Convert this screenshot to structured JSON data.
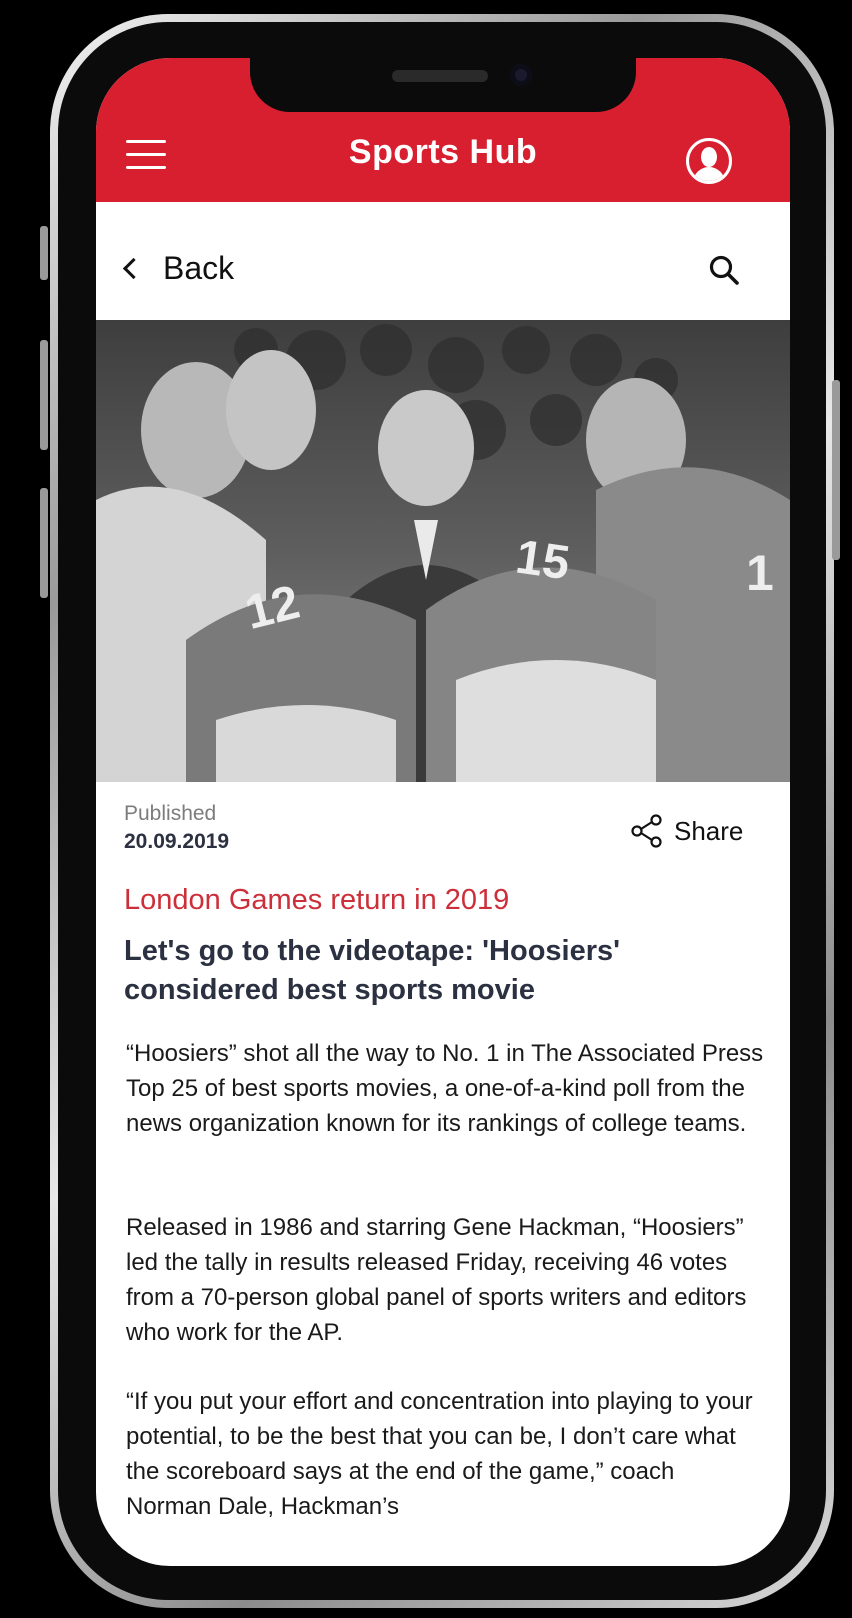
{
  "header": {
    "title": "Sports Hub",
    "menu_icon": "menu-icon",
    "profile_icon": "user-avatar-icon"
  },
  "nav": {
    "back_label": "Back",
    "search_icon": "search-icon"
  },
  "article": {
    "published_label": "Published",
    "published_date": "20.09.2019",
    "share_label": "Share",
    "kicker": "London Games return in 2019",
    "headline": "Let's go to the videotape: 'Hoosiers' considered best sports movie",
    "paragraphs": [
      "“Hoosiers” shot all the way to No. 1 in The Associated Press Top 25 of best sports movies, a one-of-a-kind poll from the news organization known for its rankings of college teams.",
      "Released in 1986 and starring Gene Hackman, “Hoosiers” led the tally in results released Friday, receiving 46 votes from a 70-person global panel of sports writers and editors who work for the AP.",
      "“If you put your effort and concentration into playing to your potential, to be the best that you can be, I don’t care what the scoreboard says at the end of the game,” coach Norman Dale, Hackman’s"
    ],
    "hero_jersey_numbers": [
      "12",
      "15",
      "1"
    ]
  },
  "colors": {
    "brand_red": "#d71f30",
    "kicker_red": "#cc2f3a",
    "headline_navy": "#2c3142"
  }
}
